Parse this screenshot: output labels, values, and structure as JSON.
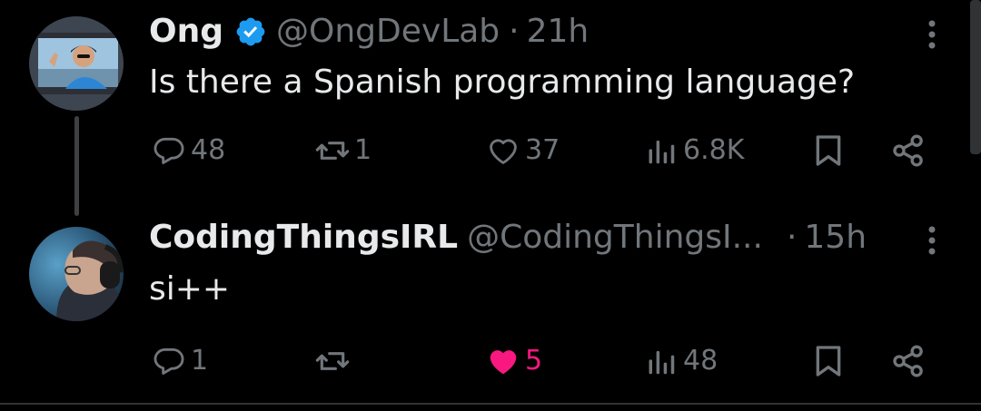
{
  "colors": {
    "background": "#000000",
    "primary_text": "#e7e9ea",
    "secondary_text": "#71767b",
    "verified_blue": "#1d9bf0",
    "like_pink": "#f91880"
  },
  "posts": [
    {
      "author_name": "Ong",
      "verified": true,
      "handle": "@OngDevLab",
      "separator": "·",
      "time": "21h",
      "text": "Is there a Spanish programming language?",
      "actions": {
        "replies": "48",
        "reposts": "1",
        "likes": "37",
        "views": "6.8K"
      },
      "liked": false
    },
    {
      "author_name": "CodingThingsIRL",
      "verified": false,
      "handle": "@CodingThingsI...",
      "separator": "·",
      "time": "15h",
      "text": "si++",
      "actions": {
        "replies": "1",
        "reposts": "",
        "likes": "5",
        "views": "48"
      },
      "liked": true
    }
  ],
  "icons": {
    "more": "more-vertical-icon",
    "reply": "reply-bubble-icon",
    "repost": "repost-arrows-icon",
    "like": "heart-icon",
    "views": "bar-chart-icon",
    "bookmark": "bookmark-icon",
    "share": "share-nodes-icon",
    "verified": "verified-badge-icon"
  }
}
